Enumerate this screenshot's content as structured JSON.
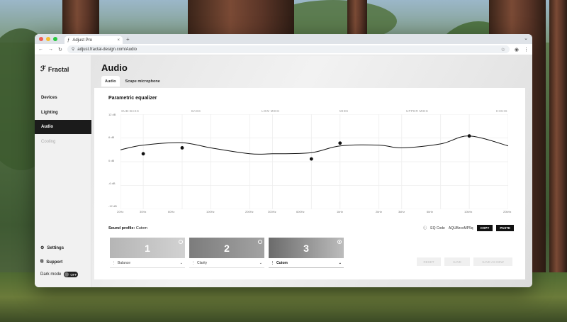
{
  "browser": {
    "tab_title": "Adjust Pro",
    "tab_close": "×",
    "new_tab": "+",
    "url": "adjust.fractal-design.com/Audio"
  },
  "sidebar": {
    "logo": "Fractal",
    "items": [
      {
        "label": "Devices",
        "state": "normal"
      },
      {
        "label": "Lighting",
        "state": "normal"
      },
      {
        "label": "Audio",
        "state": "active"
      },
      {
        "label": "Cooling",
        "state": "disabled"
      }
    ],
    "settings_label": "Settings",
    "support_label": "Support",
    "dark_mode_label": "Dark mode",
    "dark_mode_state": "OFF"
  },
  "page": {
    "title": "Audio",
    "tabs": [
      {
        "label": "Audio",
        "active": true
      },
      {
        "label": "Scape microphone",
        "active": false
      }
    ]
  },
  "equalizer": {
    "title": "Parametric equalizer",
    "bands": [
      "SUB-BASS",
      "BASS",
      "LOW MIDS",
      "MIDS",
      "UPPER MIDS",
      "HIGHS"
    ],
    "y_ticks": [
      "12 dB",
      "6 dB",
      "0 dB",
      "-6 dB",
      "-12 dB"
    ],
    "x_ticks": [
      "20Hz",
      "30Hz",
      "60Hz",
      "100Hz",
      "200Hz",
      "300Hz",
      "600Hz",
      "1kHz",
      "2kHz",
      "3kHz",
      "6kHz",
      "10kHz",
      "20kHz"
    ]
  },
  "chart_data": {
    "type": "line",
    "x_scale": "log",
    "xlim": [
      20,
      20000
    ],
    "ylim": [
      -12,
      12
    ],
    "curve": {
      "x": [
        20,
        30,
        60,
        100,
        200,
        300,
        600,
        1000,
        2000,
        3000,
        6000,
        10000,
        20000
      ],
      "y": [
        3,
        4.2,
        4.8,
        3.5,
        2,
        2,
        2.3,
        4,
        4.2,
        3.5,
        4.5,
        6.5,
        4
      ]
    },
    "points": [
      {
        "x": 30,
        "y": 2
      },
      {
        "x": 60,
        "y": 3.5
      },
      {
        "x": 600,
        "y": 0.7
      },
      {
        "x": 1000,
        "y": 4.7
      },
      {
        "x": 10000,
        "y": 6.5
      }
    ],
    "grid": true,
    "colors": {
      "curve": "#111111",
      "grid": "#eeeeee",
      "point": "#111111"
    }
  },
  "sound_profile": {
    "label": "Sound profile:",
    "value": "Cutom",
    "eq_code_label": "EQ Code",
    "eq_code": "AQUBzcxMP5q",
    "copy_label": "COPY",
    "paste_label": "PASTE",
    "presets": [
      {
        "number": "1",
        "name": "Balance",
        "selected": false
      },
      {
        "number": "2",
        "name": "Clarity",
        "selected": false
      },
      {
        "number": "3",
        "name": "Cutom",
        "selected": true
      }
    ],
    "reset_label": "RESET",
    "save_label": "SAVE",
    "save_as_new_label": "SAVE AS NEW"
  }
}
